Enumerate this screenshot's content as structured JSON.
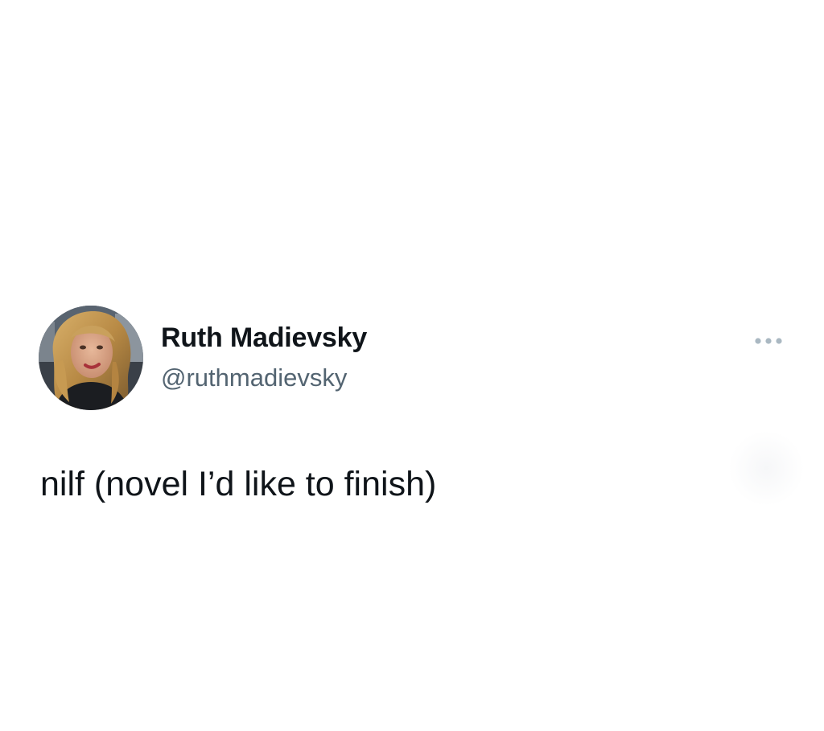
{
  "tweet": {
    "author": {
      "display_name": "Ruth Madievsky",
      "handle": "@ruthmadievsky",
      "avatar_icon": "profile-photo"
    },
    "text": "nilf (novel I’d like to finish)",
    "more_icon": "ellipsis-icon"
  },
  "colors": {
    "background": "#ffffff",
    "primary_text": "#0f1419",
    "secondary_text": "#536471",
    "icon": "#aab8c2"
  }
}
